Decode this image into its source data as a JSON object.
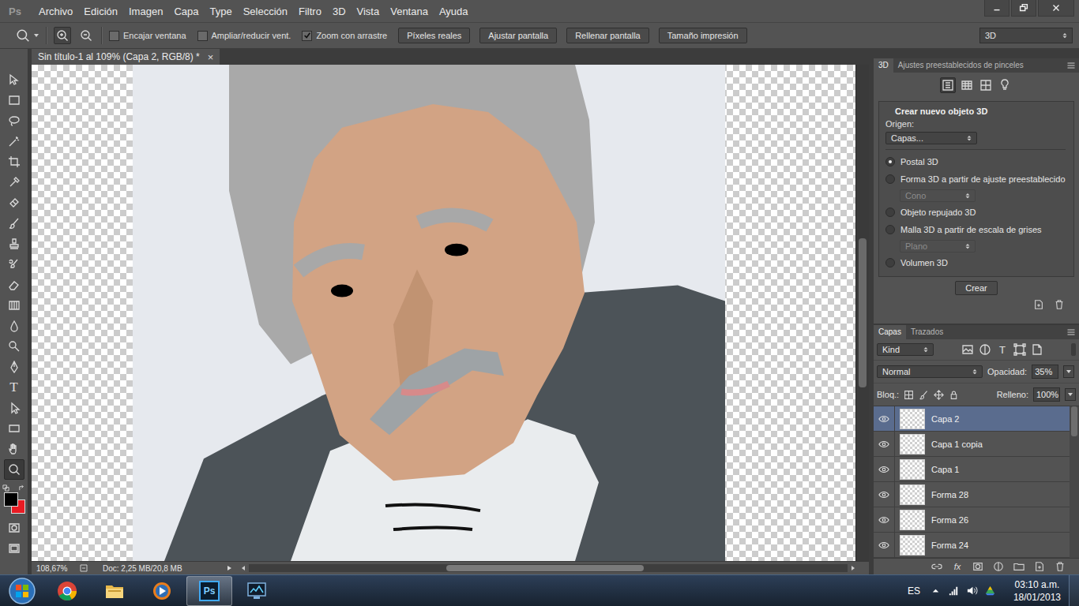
{
  "app": {
    "logo": "Ps"
  },
  "menu": [
    "Archivo",
    "Edición",
    "Imagen",
    "Capa",
    "Type",
    "Selección",
    "Filtro",
    "3D",
    "Vista",
    "Ventana",
    "Ayuda"
  ],
  "options_bar": {
    "zoom_modes": [
      {
        "kind": "zoom-in",
        "selected": true
      },
      {
        "kind": "zoom-out",
        "selected": false
      }
    ],
    "checkboxes": [
      {
        "label": "Encajar ventana",
        "checked": false
      },
      {
        "label": "Ampliar/reducir vent.",
        "checked": false
      },
      {
        "label": "Zoom con arrastre",
        "checked": true
      }
    ],
    "buttons": [
      "Píxeles reales",
      "Ajustar pantalla",
      "Rellenar pantalla",
      "Tamaño impresión"
    ],
    "workspace": "3D"
  },
  "document": {
    "tab": "Sin título-1 al 109% (Capa 2, RGB/8) *",
    "close": "×"
  },
  "scrollbars": {
    "vertical": {
      "offset": 0.35,
      "size": 0.3
    },
    "horizontal": {
      "offset": 0.33,
      "size": 0.33
    }
  },
  "status_bar": {
    "zoom": "108,67%",
    "doc": "Doc: 2,25 MB/20,8 MB"
  },
  "tools": [
    {
      "kind": "move",
      "selected": false
    },
    {
      "kind": "marquee",
      "selected": false
    },
    {
      "kind": "lasso",
      "selected": false
    },
    {
      "kind": "wand",
      "selected": false
    },
    {
      "kind": "crop",
      "selected": false
    },
    {
      "kind": "eyedropper",
      "selected": false
    },
    {
      "kind": "healing",
      "selected": false
    },
    {
      "kind": "brush",
      "selected": false
    },
    {
      "kind": "stamp",
      "selected": false
    },
    {
      "kind": "history",
      "selected": false
    },
    {
      "kind": "eraser",
      "selected": false
    },
    {
      "kind": "gradient",
      "selected": false
    },
    {
      "kind": "blur",
      "selected": false
    },
    {
      "kind": "dodge",
      "selected": false
    },
    {
      "kind": "pen",
      "selected": false
    },
    {
      "kind": "type",
      "label": "T",
      "selected": false
    },
    {
      "kind": "pathselect",
      "selected": false
    },
    {
      "kind": "rectangle",
      "selected": false
    },
    {
      "kind": "hand",
      "selected": false
    },
    {
      "kind": "zoom",
      "selected": true
    }
  ],
  "colors": {
    "foreground": "#000000",
    "background": "#e81c24"
  },
  "panel_3d": {
    "tabs": [
      {
        "label": "3D",
        "selected": true
      },
      {
        "label": "Ajustes preestablecidos de pinceles",
        "selected": false
      }
    ],
    "icons": [
      {
        "kind": "scene",
        "selected": true
      },
      {
        "kind": "mesh",
        "selected": false
      },
      {
        "kind": "material",
        "selected": false
      },
      {
        "kind": "light",
        "selected": false
      }
    ],
    "heading": "Crear nuevo objeto 3D",
    "origin_label": "Origen:",
    "origin": "Capas...",
    "options": [
      {
        "kind": "radio",
        "label": "Postal 3D",
        "selected": true,
        "disabled": false
      },
      {
        "kind": "radio",
        "label": "Forma 3D a partir de ajuste preestablecido",
        "selected": false,
        "disabled": false
      },
      {
        "kind": "select",
        "label": "Cono",
        "selected": false,
        "disabled": true
      },
      {
        "kind": "radio",
        "label": "Objeto repujado 3D",
        "selected": false,
        "disabled": false
      },
      {
        "kind": "radio",
        "label": "Malla 3D a partir de escala de grises",
        "selected": false,
        "disabled": false
      },
      {
        "kind": "select",
        "label": "Plano",
        "selected": false,
        "disabled": true
      },
      {
        "kind": "radio",
        "label": "Volumen 3D",
        "selected": false,
        "disabled": false
      }
    ],
    "button": "Crear"
  },
  "layers_panel": {
    "tabs": [
      {
        "label": "Capas",
        "selected": true
      },
      {
        "label": "Trazados",
        "selected": false
      }
    ],
    "filter": "Kind",
    "filter_icons": [
      {
        "kind": "image"
      },
      {
        "kind": "adjust"
      },
      {
        "kind": "typefilter",
        "label": "T"
      },
      {
        "kind": "shape"
      },
      {
        "kind": "smart"
      }
    ],
    "blend_mode": "Normal",
    "opacity_label": "Opacidad:",
    "opacity": "35%",
    "lock_label": "Bloq.:",
    "lock_icons": [
      {
        "kind": "lock-transparent"
      },
      {
        "kind": "lock-paint"
      },
      {
        "kind": "lock-move"
      },
      {
        "kind": "lock-all"
      }
    ],
    "fill_label": "Relleno:",
    "fill": "100%",
    "layers": [
      {
        "name": "Capa 2",
        "selected": true,
        "visible": true
      },
      {
        "name": "Capa 1 copia",
        "selected": false,
        "visible": true
      },
      {
        "name": "Capa 1",
        "selected": false,
        "visible": true
      },
      {
        "name": "Forma 28",
        "selected": false,
        "visible": true
      },
      {
        "name": "Forma 26",
        "selected": false,
        "visible": true
      },
      {
        "name": "Forma 24",
        "selected": false,
        "visible": true
      }
    ],
    "scroll": {
      "offset": 0.0,
      "size": 0.2
    },
    "bottom_icons": [
      {
        "kind": "link"
      },
      {
        "kind": "fx",
        "label": "fx"
      },
      {
        "kind": "mask"
      },
      {
        "kind": "adjust"
      },
      {
        "kind": "group"
      },
      {
        "kind": "newlayer"
      },
      {
        "kind": "trash"
      }
    ]
  },
  "taskbar": {
    "apps": [
      {
        "kind": "chrome",
        "active": false
      },
      {
        "kind": "explorer",
        "active": false
      },
      {
        "kind": "media",
        "active": false
      },
      {
        "kind": "photoshop",
        "label": "Ps",
        "active": true
      },
      {
        "kind": "monitor",
        "active": false
      }
    ],
    "language": "ES",
    "time": "03:10 a.m.",
    "date": "18/01/2013"
  }
}
